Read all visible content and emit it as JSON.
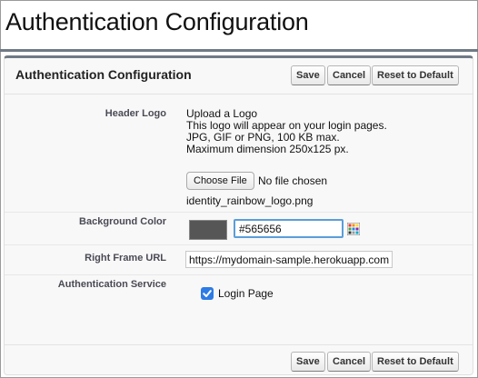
{
  "page": {
    "title": "Authentication Configuration"
  },
  "panel": {
    "title": "Authentication Configuration",
    "buttons": {
      "save": "Save",
      "cancel": "Cancel",
      "reset": "Reset to Default"
    }
  },
  "fields": {
    "header_logo": {
      "label": "Header Logo",
      "line1": "Upload a Logo",
      "line2": "This logo will appear on your login pages.",
      "line3": "JPG, GIF or PNG, 100 KB max.",
      "line4": "Maximum dimension 250x125 px.",
      "choose_button": "Choose File",
      "no_file": "No file chosen",
      "current_file": "identity_rainbow_logo.png"
    },
    "background_color": {
      "label": "Background Color",
      "value": "#565656",
      "swatch_color": "#565656"
    },
    "right_frame_url": {
      "label": "Right Frame URL",
      "value": "https://mydomain-sample.herokuapp.com"
    },
    "authentication_service": {
      "label": "Authentication Service",
      "option": "Login Page",
      "checked": true
    }
  },
  "colors": {
    "accent_rule": "#6f7a85",
    "focus_ring": "#5b9dd9",
    "checkbox": "#2d7be5"
  },
  "icons": {
    "color_picker": "palette-grid-icon",
    "checkbox": "checkmark-icon"
  }
}
